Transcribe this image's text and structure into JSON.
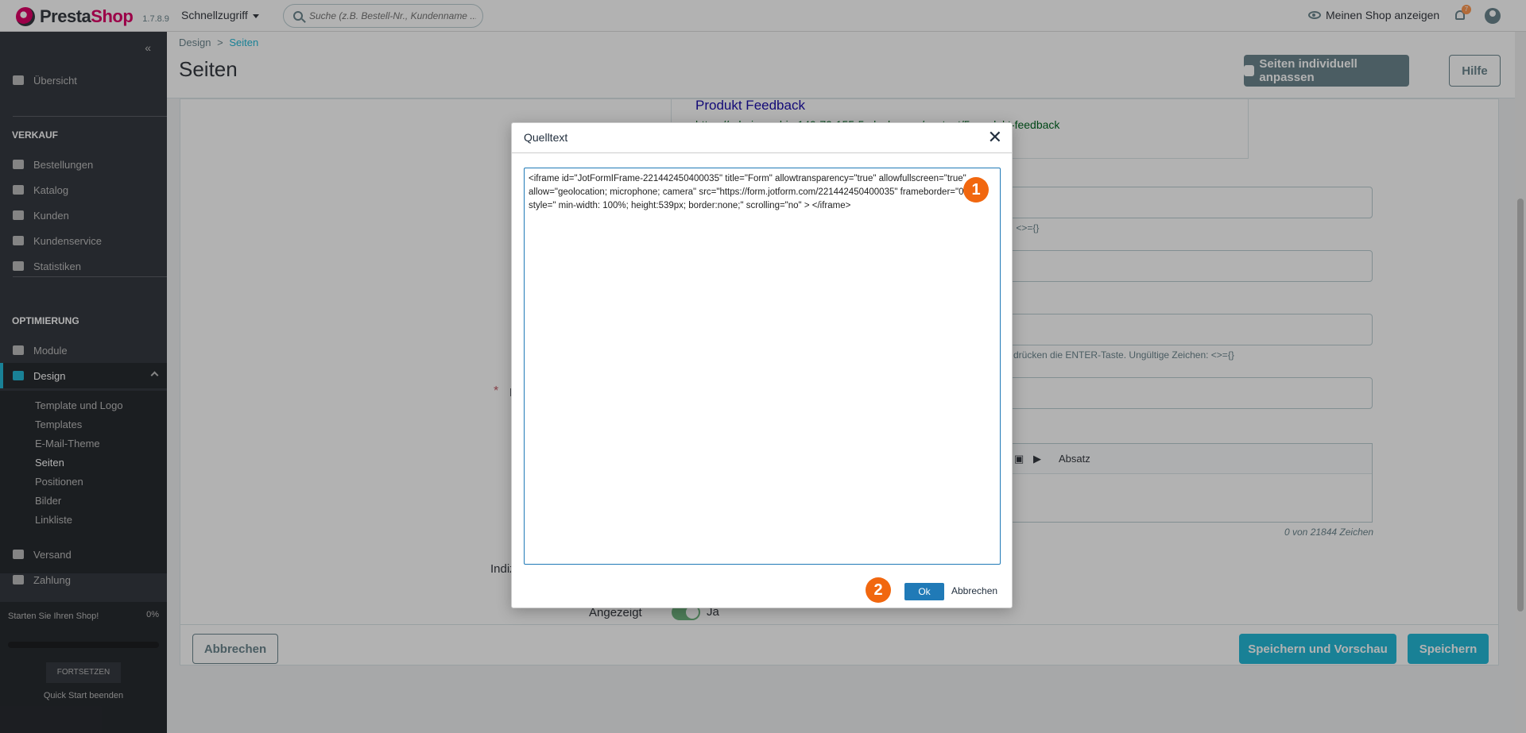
{
  "header": {
    "brand_a": "Presta",
    "brand_b": "Shop",
    "version": "1.7.8.9",
    "quick_access": "Schnellzugriff",
    "search_placeholder": "Suche (z.B. Bestell-Nr., Kundenname ...",
    "view_shop": "Meinen Shop anzeigen",
    "notification_count": "7"
  },
  "sidebar": {
    "collapse": "«",
    "overview": "Übersicht",
    "section_sales": "VERKAUF",
    "sales_items": [
      "Bestellungen",
      "Katalog",
      "Kunden",
      "Kundenservice",
      "Statistiken"
    ],
    "section_optimize": "OPTIMIERUNG",
    "modules": "Module",
    "design": "Design",
    "design_sub": [
      "Template und Logo",
      "Templates",
      "E-Mail-Theme",
      "Seiten",
      "Positionen",
      "Bilder",
      "Linkliste"
    ],
    "shipping": "Versand",
    "payment": "Zahlung",
    "quickstart_text": "Starten Sie Ihren Shop!",
    "quickstart_percent": "0%",
    "quickstart_button": "FORTSETZEN",
    "quickstart_end": "Quick Start beenden"
  },
  "pagehead": {
    "breadcrumb_parent": "Design",
    "breadcrumb_sep": ">",
    "breadcrumb_current": "Seiten",
    "title": "Seiten",
    "customize_button": "Seiten individuell anpassen",
    "help_button": "Hilfe"
  },
  "form": {
    "preview_title": "Produkt Feedback",
    "preview_url": "https://adoring-rubin.149-79-155-5.plesk.page/content/5-produkt-feedback",
    "hint_1": "n: <>={}",
    "hint_2": "d drücken die ENTER-Taste. Ungültige Zeichen: <>={}",
    "editor_format": "Absatz",
    "counter": "0 von 21844 Zeichen",
    "label_partial": "E",
    "label_index": "Indiz",
    "label_displayed": "Angezeigt",
    "displayed_value": "Ja",
    "required_mark": "*"
  },
  "footer": {
    "cancel": "Abbrechen",
    "save_preview": "Speichern und Vorschau",
    "save": "Speichern"
  },
  "dialog": {
    "title": "Quelltext",
    "close": "✕",
    "code": "<iframe id=\"JotFormIFrame-221442450400035\" title=\"Form\" allowtransparency=\"true\" allowfullscreen=\"true\" allow=\"geolocation; microphone; camera\" src=\"https://form.jotform.com/221442450400035\" frameborder=\"0\" style=\" min-width: 100%; height:539px; border:none;\" scrolling=\"no\" > </iframe>",
    "ok": "Ok",
    "cancel": "Abbrechen",
    "step_1": "1",
    "step_2": "2"
  }
}
